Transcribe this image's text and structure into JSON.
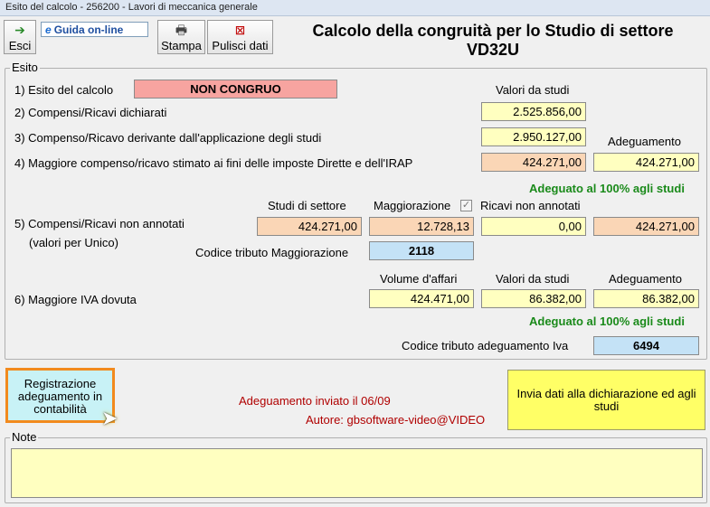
{
  "window": {
    "title": "Esito del calcolo - 256200 - Lavori di meccanica generale"
  },
  "toolbar": {
    "exit": "Esci",
    "guide": "Guida on-line",
    "print": "Stampa",
    "clear": "Pulisci dati"
  },
  "header": {
    "title_line1": "Calcolo della congruità per lo Studio di settore",
    "title_line2": "VD32U"
  },
  "esito": {
    "legend": "Esito",
    "row1": {
      "label": "1) Esito del calcolo",
      "value": "NON CONGRUO"
    },
    "col_valori_studi": "Valori da studi",
    "row2": {
      "label": "2) Compensi/Ricavi dichiarati",
      "value": "2.525.856,00"
    },
    "row3": {
      "label": "3) Compenso/Ricavo derivante dall'applicazione degli studi",
      "value": "2.950.127,00"
    },
    "col_adeguamento": "Adeguamento",
    "row4": {
      "label": "4) Maggiore compenso/ricavo stimato ai fini delle imposte Dirette e dell'IRAP",
      "value": "424.271,00",
      "adeguamento": "424.271,00"
    },
    "status1": "Adeguato al 100% agli studi",
    "col_studi_settore": "Studi di settore",
    "col_maggiorazione": "Maggiorazione",
    "col_ricavi_non_annotati": "Ricavi non annotati",
    "row5": {
      "label": "5) Compensi/Ricavi non annotati",
      "sublabel": "(valori per Unico)",
      "studi": "424.271,00",
      "maggiorazione": "12.728,13",
      "ricavi": "0,00",
      "adeguamento": "424.271,00"
    },
    "codice_maggiorazione": {
      "label": "Codice tributo Maggiorazione",
      "value": "2118"
    },
    "col_volume": "Volume d'affari",
    "col_valori_studi2": "Valori da studi",
    "col_adeguamento2": "Adeguamento",
    "row6": {
      "label": "6) Maggiore IVA dovuta",
      "volume": "424.471,00",
      "valori": "86.382,00",
      "adeguamento": "86.382,00"
    },
    "status2": "Adeguato al 100% agli studi",
    "codice_iva": {
      "label": "Codice tributo adeguamento Iva",
      "value": "6494"
    }
  },
  "footer": {
    "register_button": "Registrazione adeguamento in contabilità",
    "sent_text": "Adeguamento inviato il 06/09",
    "author_text": "Autore: gbsoftware-video@VIDEO",
    "send_button": "Invia dati alla dichiarazione ed agli studi"
  },
  "note": {
    "legend": "Note",
    "value": ""
  }
}
